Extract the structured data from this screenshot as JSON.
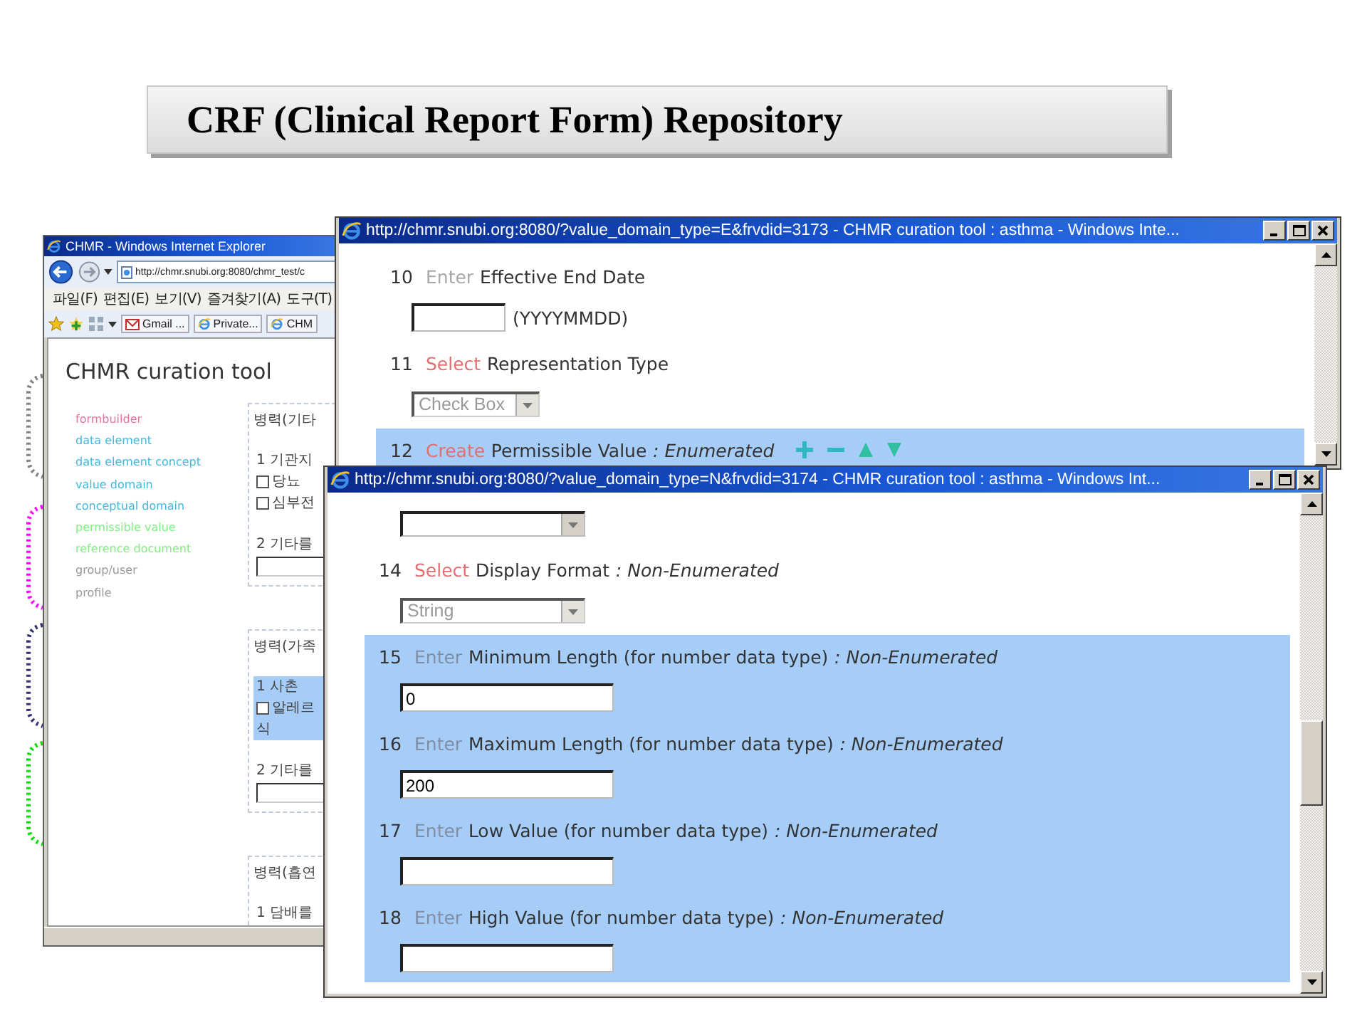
{
  "slide_title": "CRF (Clinical Report Form) Repository",
  "brackets": [
    {
      "color": "#808080"
    },
    {
      "color": "#ff00ff"
    },
    {
      "color": "#303070"
    },
    {
      "color": "#00dd00"
    }
  ],
  "back_window": {
    "title": "CHMR - Windows Internet Explorer",
    "address": "http://chmr.snubi.org:8080/chmr_test/c",
    "menu": [
      "파일(F)",
      "편집(E)",
      "보기(V)",
      "즐겨찾기(A)",
      "도구(T)"
    ],
    "favorites": [
      {
        "kind": "mail",
        "label": "Gmail ..."
      },
      {
        "kind": "page",
        "label": "Private..."
      },
      {
        "kind": "page",
        "label": "CHM"
      }
    ],
    "heading": "CHMR curation tool",
    "nav": [
      {
        "label": "formbuilder",
        "color": "#f070a0"
      },
      {
        "label": "data element",
        "color": "#40b8e0"
      },
      {
        "label": "data element concept",
        "color": "#40b8e0"
      },
      {
        "label": "value domain",
        "color": "#40b8e0"
      },
      {
        "label": "conceptual domain",
        "color": "#40b8e0"
      },
      {
        "label": "permissible value",
        "color": "#80f080"
      },
      {
        "label": "reference document",
        "color": "#80f080"
      },
      {
        "label": "group/user",
        "color": "#999999"
      },
      {
        "label": "profile",
        "color": "#999999"
      }
    ],
    "sections": [
      {
        "heading": "병력(기타",
        "items": [
          {
            "kind": "text",
            "text": "1 기관지",
            "highlighted": false
          },
          {
            "kind": "check",
            "label": "당뇨",
            "checked": false,
            "highlighted": false
          },
          {
            "kind": "check",
            "label": "심부전",
            "checked": false,
            "highlighted": false
          },
          {
            "kind": "text",
            "text": "2 기타를",
            "highlighted": false
          },
          {
            "kind": "input",
            "highlighted": false
          }
        ]
      },
      {
        "heading": "병력(가족",
        "items": [
          {
            "kind": "text",
            "text": "1 사촌",
            "highlighted": true
          },
          {
            "kind": "check",
            "label": "알레르",
            "checked": false,
            "highlighted": true
          },
          {
            "kind": "text",
            "text": "식",
            "highlighted": true
          },
          {
            "kind": "text",
            "text": "2 기타를",
            "highlighted": false
          },
          {
            "kind": "input",
            "highlighted": false
          }
        ]
      },
      {
        "heading": "병력(흡연",
        "items": [
          {
            "kind": "text",
            "text": "1 담배를",
            "highlighted": false
          }
        ]
      }
    ]
  },
  "front_windows": [
    {
      "title": "http://chmr.snubi.org:8080/?value_domain_type=E&frvdid=3173 - CHMR curation tool : asthma - Windows Inte...",
      "items": [
        {
          "kind": "question",
          "number": "10",
          "verb": {
            "text": "Enter",
            "color": "#a8a8a8"
          },
          "label": "Effective End Date",
          "highlighted": false
        },
        {
          "kind": "input",
          "suffix": "(YYYYMMDD)",
          "highlighted": false
        },
        {
          "kind": "question",
          "number": "11",
          "verb": {
            "text": "Select",
            "color": "#e07070"
          },
          "label": "Representation Type",
          "highlighted": false
        },
        {
          "kind": "select",
          "value": "Check Box",
          "disabled": true,
          "highlighted": false
        },
        {
          "kind": "question",
          "number": "12",
          "verb": {
            "text": "Create",
            "color": "#e07070"
          },
          "label": "Permissible Value",
          "qualifier": ": Enumerated",
          "tools": true,
          "highlighted": true
        }
      ]
    },
    {
      "title": "http://chmr.snubi.org:8080/?value_domain_type=N&frvdid=3174 - CHMR curation tool : asthma - Windows Int...",
      "items": [
        {
          "kind": "select",
          "disabled": false,
          "highlighted": false
        },
        {
          "kind": "question",
          "number": "14",
          "verb": {
            "text": "Select",
            "color": "#e07070"
          },
          "label": "Display Format",
          "qualifier": ": Non-Enumerated",
          "highlighted": false
        },
        {
          "kind": "select",
          "value": "String",
          "disabled": true,
          "highlighted": false
        },
        {
          "kind": "question",
          "number": "15",
          "verb": {
            "text": "Enter",
            "color": "#7f8ea4"
          },
          "label": "Minimum Length (for number data type)",
          "qualifier": ": Non-Enumerated",
          "highlighted": true
        },
        {
          "kind": "input",
          "value": "0",
          "highlighted": true
        },
        {
          "kind": "question",
          "number": "16",
          "verb": {
            "text": "Enter",
            "color": "#7f8ea4"
          },
          "label": "Maximum Length (for number data type)",
          "qualifier": ": Non-Enumerated",
          "highlighted": true
        },
        {
          "kind": "input",
          "value": "200",
          "highlighted": true
        },
        {
          "kind": "question",
          "number": "17",
          "verb": {
            "text": "Enter",
            "color": "#7f8ea4"
          },
          "label": "Low Value (for number data type)",
          "qualifier": ": Non-Enumerated",
          "highlighted": true
        },
        {
          "kind": "input",
          "highlighted": true
        },
        {
          "kind": "question",
          "number": "18",
          "verb": {
            "text": "Enter",
            "color": "#7f8ea4"
          },
          "label": "High Value (for number data type)",
          "qualifier": ": Non-Enumerated",
          "highlighted": true
        },
        {
          "kind": "input",
          "highlighted": true
        }
      ]
    }
  ]
}
